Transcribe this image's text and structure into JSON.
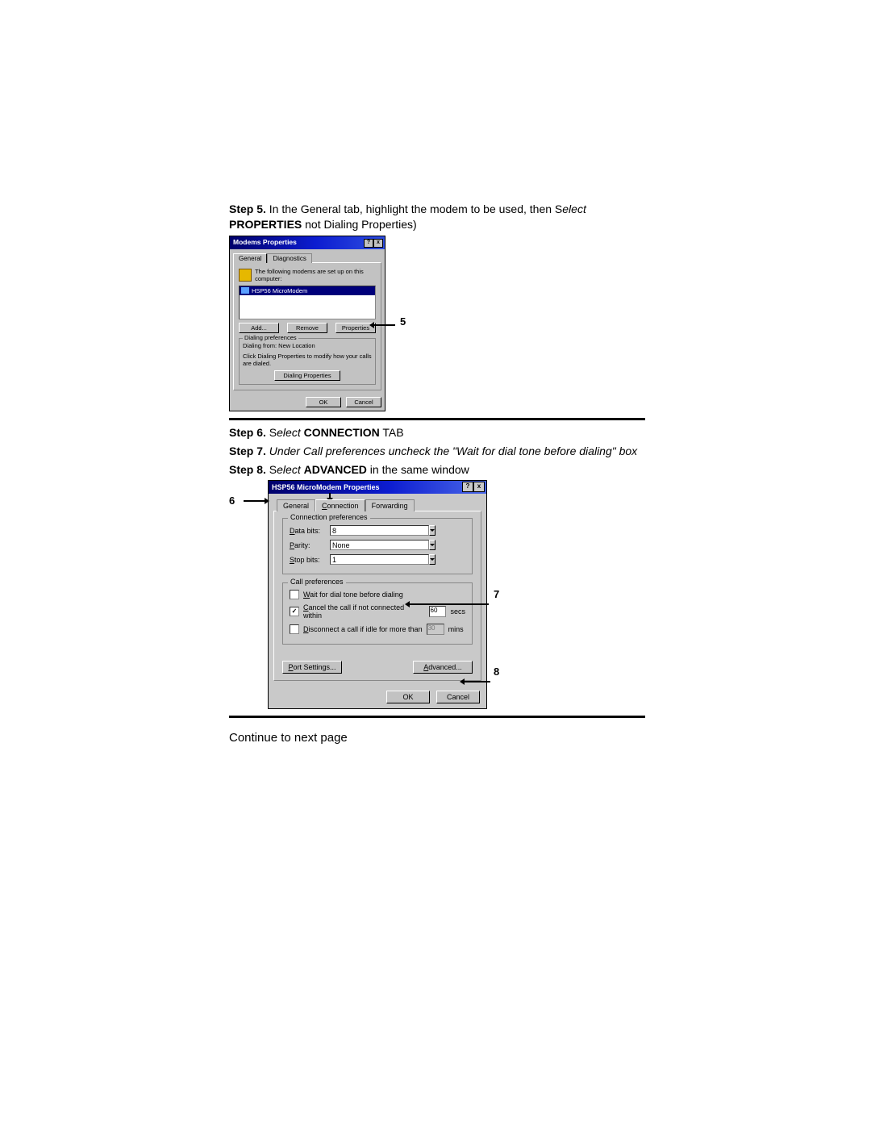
{
  "step5": {
    "label": "Step 5.",
    "text1": " In the General tab, highlight the modem to be used, then S",
    "text2_italic": "elect ",
    "text3_bold": "PROPERTIES",
    "text4": " not Dialing Properties)"
  },
  "step6": {
    "label": "Step 6.",
    "s": " S",
    "elect": "elect ",
    "bold": "CONNECTION",
    "tail": " TAB"
  },
  "step7": {
    "label": "Step 7.",
    "italic": " Under Call preferences uncheck the \"Wait for dial tone before dialing\" box"
  },
  "step8": {
    "label": "Step 8.",
    "s": " S",
    "elect": "elect ",
    "bold": "ADVANCED",
    "tail": " in the same window"
  },
  "continue": "Continue to next page",
  "dlg1": {
    "title": "Modems Properties",
    "tabs": {
      "general": "General",
      "diagnostics": "Diagnostics"
    },
    "intro": "The following modems are set up on this computer:",
    "modem_item": "HSP56 MicroModem",
    "btn_add": "Add...",
    "btn_remove": "Remove",
    "btn_properties": "Properties",
    "group": "Dialing preferences",
    "dialing_from": "Dialing from: New Location",
    "dialing_hint": "Click Dialing Properties to modify how your calls are dialed.",
    "btn_dialing": "Dialing Properties",
    "ok": "OK",
    "cancel": "Cancel"
  },
  "dlg2": {
    "title": "HSP56 MicroModem Properties",
    "tabs": {
      "general": "General",
      "connection": "Connection",
      "forwarding": "Forwarding"
    },
    "group_conn": "Connection preferences",
    "data_bits_label": "Data bits:",
    "data_bits_ul": "D",
    "data_bits_value": "8",
    "parity_label": "arity:",
    "parity_ul": "P",
    "parity_value": "None",
    "stop_bits_label": "top bits:",
    "stop_bits_ul": "S",
    "stop_bits_value": "1",
    "group_call": "Call preferences",
    "wait_label": "Wait for dial tone before dialing",
    "wait_ul": "W",
    "cancel_label": "Cancel the call if not connected within",
    "cancel_ul": "C",
    "cancel_value": "60",
    "cancel_unit": "secs",
    "disconnect_label": "Disconnect a call if idle for more than",
    "disconnect_ul": "D",
    "disconnect_value": "30",
    "disconnect_unit": "mins",
    "port_settings": "Port Settings...",
    "advanced": "Advanced...",
    "ok": "OK",
    "cancel": "Cancel"
  },
  "callouts": {
    "n5": "5",
    "n6": "6",
    "n7": "7",
    "n8": "8"
  }
}
